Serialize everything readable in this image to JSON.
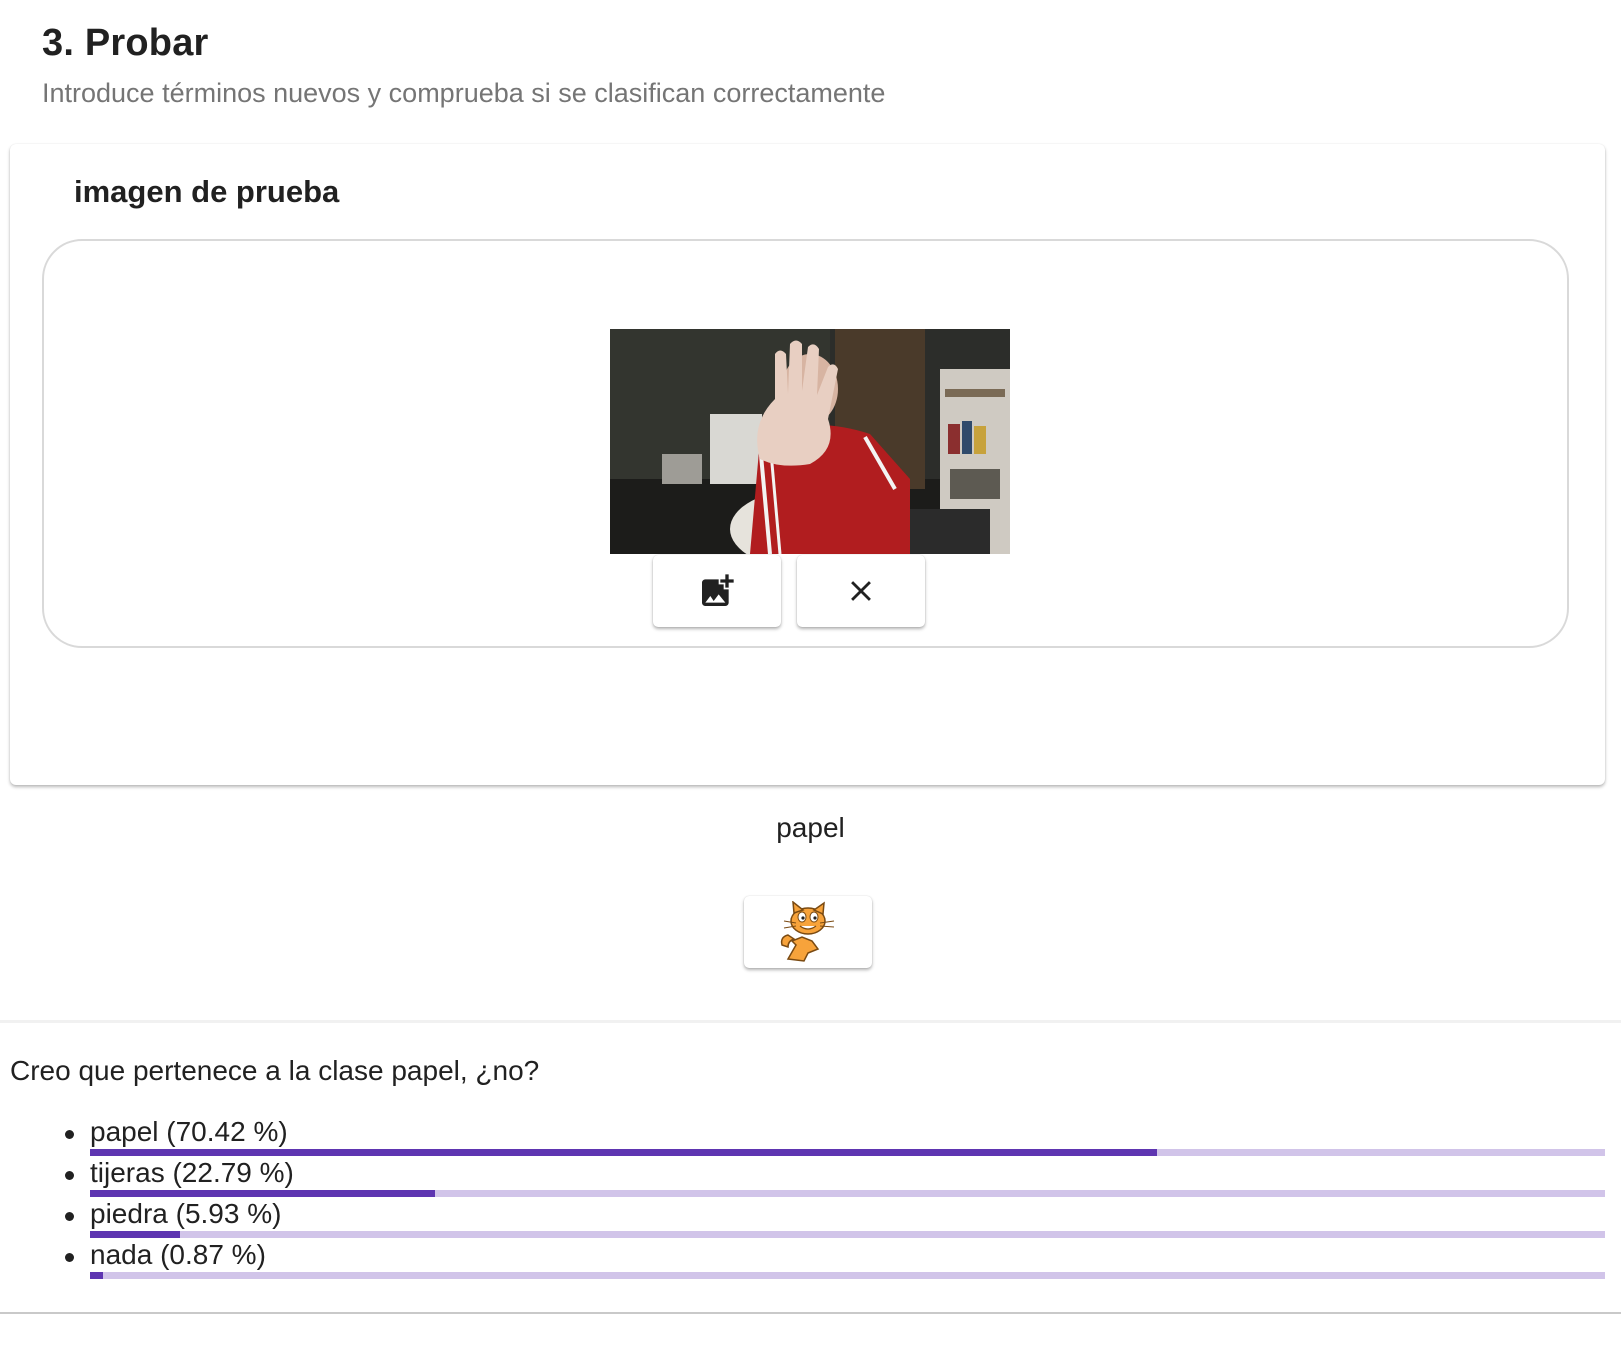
{
  "section": {
    "title": "3. Probar",
    "subtitle": "Introduce términos nuevos y comprueba si se clasifican correctamente"
  },
  "card": {
    "title": "imagen de prueba",
    "add_image_icon": "add-photo-icon",
    "clear_icon": "close-icon"
  },
  "prediction": {
    "label": "papel",
    "scratch_icon": "scratch-cat-icon"
  },
  "results": {
    "summary": "Creo que pertenece a la clase papel, ¿no?",
    "items": [
      {
        "label": "papel (70.42 %)",
        "value": 70.42
      },
      {
        "label": "tijeras (22.79 %)",
        "value": 22.79
      },
      {
        "label": "piedra (5.93 %)",
        "value": 5.93
      },
      {
        "label": "nada (0.87 %)",
        "value": 0.87
      }
    ]
  },
  "colors": {
    "bar_fill": "#5e35b1",
    "bar_track": "#d1c4e9"
  }
}
